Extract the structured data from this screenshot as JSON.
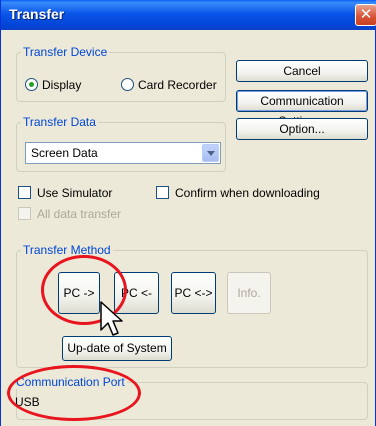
{
  "window": {
    "title": "Transfer",
    "close_glyph": "✕"
  },
  "transfer_device": {
    "label": "Transfer Device",
    "options": [
      {
        "label": "Display",
        "selected": true
      },
      {
        "label": "Card Recorder",
        "selected": false
      }
    ]
  },
  "buttons": {
    "cancel": "Cancel",
    "communication_setting": "Communication Setting...",
    "option": "Option..."
  },
  "transfer_data": {
    "label": "Transfer Data",
    "selected": "Screen Data"
  },
  "checkboxes": {
    "use_simulator": "Use Simulator",
    "confirm_downloading": "Confirm when downloading",
    "all_data_transfer": "All data transfer"
  },
  "transfer_method": {
    "label": "Transfer Method",
    "pc_to": "PC ->",
    "pc_from": "PC <-",
    "pc_both": "PC <->",
    "info": "Info.",
    "update_system": "Up-date of System"
  },
  "communication_port": {
    "label": "Communication Port",
    "value": "USB"
  },
  "annotation_color": "#e8141e"
}
